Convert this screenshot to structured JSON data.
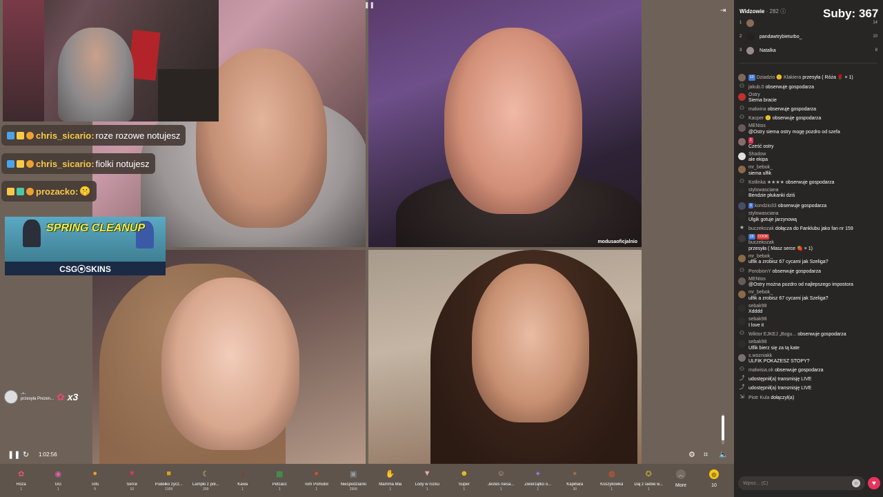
{
  "stream": {
    "top_right_caption": "modusaoficjalnio",
    "overlay_chat": [
      {
        "nick": "chris_sicario:",
        "text": "roze rozowe notujesz"
      },
      {
        "nick": "chris_sicario:",
        "text": "fiolki notujesz"
      },
      {
        "nick": "prozacko:",
        "text": "🤫"
      }
    ],
    "sponsor": {
      "title": "SPRING CLEANUP",
      "brand": "CSG⦿SKINS"
    },
    "gift_notice": {
      "user": "-+-",
      "action": "przesyła Prezen...",
      "gift_icon": "rose",
      "multiplier": "x3"
    },
    "time": "1:02:56"
  },
  "gifts": [
    {
      "name": "Róża",
      "price": "1",
      "icon": "rose",
      "color": "#e9556f",
      "glyph": "✿"
    },
    {
      "name": "GG",
      "price": "1",
      "icon": "gg",
      "color": "#e45fb0",
      "glyph": "◉"
    },
    {
      "name": "Tofu",
      "price": "5",
      "icon": "tofu",
      "color": "#f0a030",
      "glyph": "●"
    },
    {
      "name": "Serce",
      "price": "10",
      "icon": "heart",
      "color": "#e8335c",
      "glyph": "♥"
    },
    {
      "name": "Pudełko życz...",
      "price": "1999",
      "icon": "box",
      "color": "#d9a21b",
      "glyph": "■"
    },
    {
      "name": "Lampki z pół...",
      "price": "299",
      "icon": "lamp",
      "color": "#e5c86a",
      "glyph": "☾"
    },
    {
      "name": "Kawa",
      "price": "1",
      "icon": "coffee",
      "color": "#6f4a3a",
      "glyph": "▮"
    },
    {
      "name": "Petcacc",
      "price": "1",
      "icon": "creeper",
      "color": "#3aa84a",
      "glyph": "▦"
    },
    {
      "name": "Tom Pomidor",
      "price": "1",
      "icon": "tomato",
      "color": "#e24a2c",
      "glyph": "●"
    },
    {
      "name": "Niespodzianki",
      "price": "2999",
      "icon": "surprise",
      "color": "#8f9aa4",
      "glyph": "▣"
    },
    {
      "name": "Mamma Mia",
      "price": "1",
      "icon": "hand",
      "color": "#f0b8a0",
      "glyph": "✋"
    },
    {
      "name": "Lody w rożku",
      "price": "1",
      "icon": "icecream",
      "color": "#f3a6c4",
      "glyph": "▼"
    },
    {
      "name": "Super",
      "price": "1",
      "icon": "sunglasses",
      "color": "#f5c518",
      "glyph": "☻"
    },
    {
      "name": "Jesteś niesa...",
      "price": "1",
      "icon": "face",
      "color": "#d8b07a",
      "glyph": "☺"
    },
    {
      "name": "Zwierzątko o...",
      "price": "1",
      "icon": "pet",
      "color": "#9a7ad8",
      "glyph": "✦"
    },
    {
      "name": "Kapibara",
      "price": "30",
      "icon": "capybara",
      "color": "#a26a3a",
      "glyph": "●"
    },
    {
      "name": "Koszykówka",
      "price": "1",
      "icon": "basketball",
      "color": "#e2542c",
      "glyph": "◍"
    },
    {
      "name": "Daj z siebie w...",
      "price": "1",
      "icon": "medal",
      "color": "#b8a030",
      "glyph": "✪"
    }
  ],
  "more_label": "More",
  "coin_label": "10",
  "panel": {
    "viewers_label": "Widzowie",
    "viewers_count": "· 282",
    "subs": "Suby: 367",
    "top_viewers": [
      {
        "rank": "1",
        "name": "",
        "score": "14"
      },
      {
        "rank": "2",
        "name": "pandawtrybieturbo_",
        "score": "10"
      },
      {
        "rank": "3",
        "name": "Natalka",
        "score": "8"
      }
    ],
    "messages": [
      {
        "user": "Dziadzio 🙂 Klakiera",
        "text": "przesyła ( Róża 🌹 × 1)",
        "inline": true,
        "av": "#7a6a5a",
        "tag": "13",
        "tagc": "#4a7ad8"
      },
      {
        "user": "jakub.0",
        "text": "obserwuje gospodarza",
        "inline": true,
        "av": "",
        "icon": "follow"
      },
      {
        "user": "Ostry",
        "text": "Siema bracie",
        "av": "#c23030"
      },
      {
        "user": "malwina",
        "text": "obserwuje gospodarza",
        "inline": true,
        "icon": "follow"
      },
      {
        "user": "Kacper 🙂",
        "text": "obserwuje gospodarza",
        "inline": true,
        "icon": "follow"
      },
      {
        "user": "MENtos",
        "text": "@Ostry siema ostry mogę pozdro od szefa",
        "av": "#6a5a5a"
      },
      {
        "user": "",
        "text": "Cześć ostry",
        "av": "#8a6a6a",
        "tag": "1",
        "tagc": "#d83a5a"
      },
      {
        "user": "Shadow",
        "text": "ale ekipa",
        "av": "#e0e0e0"
      },
      {
        "user": "mr_bebok_",
        "text": "siema ulfik",
        "av": "#8a6a4a"
      },
      {
        "user": "Kotlinka ★★★★",
        "text": "obserwuje gospodarza",
        "inline": true,
        "icon": "follow"
      },
      {
        "user": "stylowasciana",
        "text": "Bendzie płukanki dziś",
        "av": "#2a2a2a"
      },
      {
        "user": "kondzio33",
        "text": "obserwuje gospodarza",
        "inline": true,
        "av": "#4a4a6a",
        "tag": "9",
        "tagc": "#4a7ad8"
      },
      {
        "user": "stylowasciana",
        "text": "Ulgik gotuje jarzynową",
        "av": "#2a2a2a"
      },
      {
        "user": "buczekozak",
        "text": "dołącza do Fanklubu jako fan nr 159",
        "inline": true,
        "icon": "star"
      },
      {
        "user": "buczekozak",
        "text": "przesyła ( Masz serce 🍓 × 1)",
        "av": "#3a3a3a",
        "tag": "16",
        "tagc": "#4a7ad8",
        "tag2": "COOK",
        "tag2c": "#d83a3a"
      },
      {
        "user": "mr_bebok_",
        "text": "ulfik a zrobisz 67 cycami jak Szeliga?",
        "av": "#8a6a4a"
      },
      {
        "user": "PorobionY",
        "text": "obserwuje gospodarza",
        "inline": true,
        "icon": "follow"
      },
      {
        "user": "MENtos",
        "text": "@Ostry można pozdro od najlepszego impostora",
        "av": "#6a5a5a"
      },
      {
        "user": "mr_bebok_",
        "text": "ulfik a zrobisz 67 cycami jak Szeliga?",
        "av": "#8a6a4a"
      },
      {
        "user": "sebak98",
        "text": "Xdddd",
        "av": "#2f2d2b"
      },
      {
        "user": "sebak98",
        "text": "I love it",
        "av": "#2f2d2b"
      },
      {
        "user": "Wiktor EJKEJ „Bogu...",
        "text": "obserwuje gospodarza",
        "inline": true,
        "icon": "follow"
      },
      {
        "user": "sebak98",
        "text": "Ulfik bierz się za tą kate",
        "av": "#2f2d2b"
      },
      {
        "user": "s.wozniakk",
        "text": "ULFIK POKAZESZ STOPY?",
        "av": "#7a7070"
      },
      {
        "user": "malwisia.ok",
        "text": "obserwuje gospodarza",
        "inline": true,
        "icon": "follow"
      },
      {
        "user": "",
        "text": "udostępnił(a) transmisję LIVE",
        "inline": true,
        "icon": "share"
      },
      {
        "user": "",
        "text": "udostępnił(a) transmisję LIVE",
        "inline": true,
        "icon": "share"
      },
      {
        "user": "Piotr Kula",
        "text": "dołączył(a)",
        "inline": true,
        "icon": "join"
      }
    ],
    "input_placeholder": "Wpisz... (C)"
  }
}
